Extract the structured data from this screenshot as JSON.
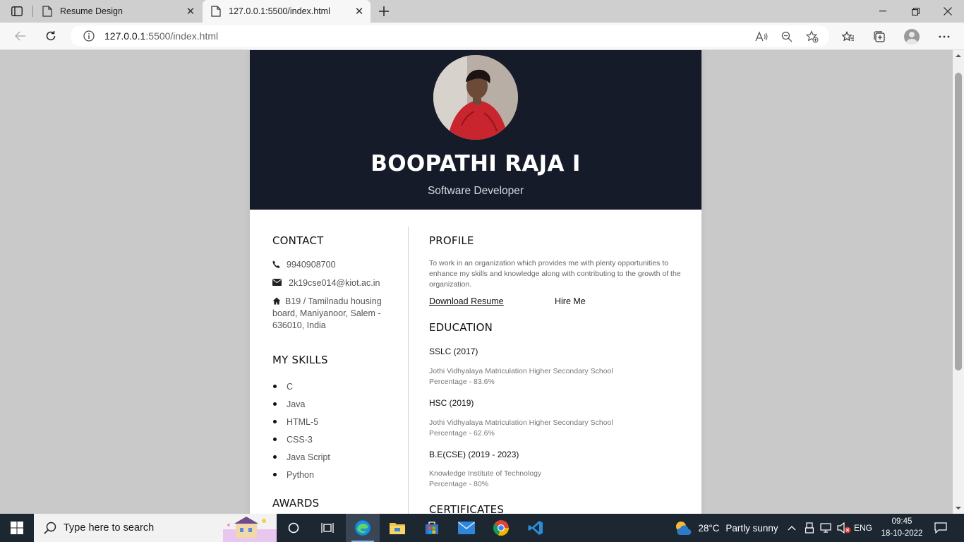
{
  "browser": {
    "tabs": [
      {
        "title": "Resume Design",
        "active": false
      },
      {
        "title": "127.0.0.1:5500/index.html",
        "active": true
      }
    ],
    "url": {
      "host": "127.0.0.1",
      "rest": ":5500/index.html"
    }
  },
  "resume": {
    "name": "BOOPATHI RAJA I",
    "role": "Software Developer",
    "contact": {
      "heading": "CONTACT",
      "phone": "9940908700",
      "email": "2k19cse014@kiot.ac.in",
      "address": "B19 / Tamilnadu housing board, Maniyanoor, Salem - 636010, India"
    },
    "skills": {
      "heading": "MY SKILLS",
      "items": [
        "C",
        "Java",
        "HTML-5",
        "CSS-3",
        "Java Script",
        "Python"
      ]
    },
    "awards_heading": "AWARDS",
    "profile": {
      "heading": "PROFILE",
      "text": "To work in an organization which provides me with plenty opportunities to enhance my skills and knowledge along with contributing to the growth of the organization.",
      "download_label": "Download Resume",
      "hire_label": "Hire Me"
    },
    "education": {
      "heading": "EDUCATION",
      "items": [
        {
          "title": "SSLC (2017)",
          "school": "Jothi Vidhyalaya Matriculation Higher Secondary School",
          "score": "Percentage - 83.6%"
        },
        {
          "title": "HSC (2019)",
          "school": "Jothi Vidhyalaya Matriculation Higher Secondary School",
          "score": "Percentage - 62.6%"
        },
        {
          "title": "B.E(CSE) (2019 - 2023)",
          "school": "Knowledge Institute of Technology",
          "score": "Percentage - 80%"
        }
      ]
    },
    "certificates_heading": "CERTIFICATES"
  },
  "taskbar": {
    "search_placeholder": "Type here to search",
    "weather": {
      "temp": "28°C",
      "desc": "Partly sunny"
    },
    "lang": "ENG",
    "time": "09:45",
    "date": "18-10-2022"
  },
  "colors": {
    "hero_bg": "#161b29",
    "taskbar_bg": "#1c2732",
    "page_bg": "#c9c9c9"
  }
}
